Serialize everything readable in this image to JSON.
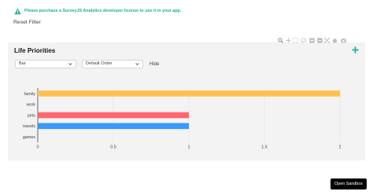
{
  "banner": {
    "text": "Please purchase a SurveyJS Analytics developer license to use it in your app.",
    "icon": "warning-icon",
    "color": "#19b394"
  },
  "reset_filter_label": "Reset Filter",
  "panel": {
    "title": "Life Priorities",
    "toggle_icon": "plus-icon",
    "chart_type_select": {
      "value": "Bar"
    },
    "order_select": {
      "value": "Default Order"
    },
    "hide_label": "Hide"
  },
  "modebar_icons": [
    "zoom-icon",
    "pan-icon",
    "box-select-icon",
    "lasso-select-icon",
    "zoom-in-icon",
    "zoom-out-icon",
    "autoscale-icon",
    "reset-axes-icon",
    "camera-icon"
  ],
  "chart_data": {
    "type": "bar",
    "orientation": "horizontal",
    "categories": [
      "family",
      "work",
      "pets",
      "travels",
      "games"
    ],
    "values": [
      2,
      0,
      1,
      1,
      0
    ],
    "colors": [
      "#ffc152",
      "#1ab7fa",
      "#ff6771",
      "#3999fb",
      "#19b394"
    ],
    "xticks": [
      0,
      0.5,
      1,
      1.5,
      2
    ],
    "xtick_labels": [
      "0",
      "0.5",
      "1",
      "1.5",
      "2"
    ],
    "xlim": [
      0,
      2.05
    ],
    "grid": true,
    "legend": false
  },
  "open_sandbox_label": "Open Sandbox"
}
